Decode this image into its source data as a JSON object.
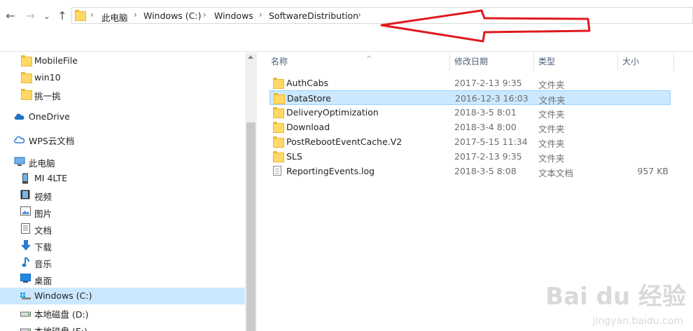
{
  "address": {
    "crumbs": [
      "此电脑",
      "Windows (C:)",
      "Windows",
      "SoftwareDistribution"
    ],
    "separator": "›"
  },
  "nav_glyphs": {
    "back": "←",
    "forward": "→",
    "recent": "⌄",
    "up": "↑"
  },
  "nav": {
    "items": [
      {
        "label": "MobileFile",
        "icon": "folder-icon"
      },
      {
        "label": "win10",
        "icon": "folder-icon"
      },
      {
        "label": "挑一挑",
        "icon": "folder-icon"
      },
      {
        "label": "OneDrive",
        "icon": "cloud-icon"
      },
      {
        "label": "WPS云文档",
        "icon": "wps-cloud-icon"
      },
      {
        "label": "此电脑",
        "icon": "computer-icon"
      },
      {
        "label": "MI 4LTE",
        "icon": "phone-icon"
      },
      {
        "label": "视频",
        "icon": "video-icon"
      },
      {
        "label": "图片",
        "icon": "picture-icon"
      },
      {
        "label": "文档",
        "icon": "document-icon"
      },
      {
        "label": "下载",
        "icon": "download-icon"
      },
      {
        "label": "音乐",
        "icon": "music-icon"
      },
      {
        "label": "桌面",
        "icon": "desktop-icon"
      },
      {
        "label": "Windows (C:)",
        "icon": "drive-icon"
      },
      {
        "label": "本地磁盘 (D:)",
        "icon": "drive-icon"
      },
      {
        "label": "本地磁盘 (E:)",
        "icon": "drive-icon"
      }
    ],
    "selected": "Windows (C:)"
  },
  "columns": {
    "name": "名称",
    "date": "修改日期",
    "type": "类型",
    "size": "大小"
  },
  "sort_caret": "^",
  "files": [
    {
      "name": "AuthCabs",
      "date": "2017-2-13 9:35",
      "type": "文件夹",
      "size": "",
      "icon": "folder-icon"
    },
    {
      "name": "DataStore",
      "date": "2016-12-3 16:03",
      "type": "文件夹",
      "size": "",
      "icon": "folder-icon"
    },
    {
      "name": "DeliveryOptimization",
      "date": "2018-3-5 8:01",
      "type": "文件夹",
      "size": "",
      "icon": "folder-icon"
    },
    {
      "name": "Download",
      "date": "2018-3-4 8:00",
      "type": "文件夹",
      "size": "",
      "icon": "folder-icon"
    },
    {
      "name": "PostRebootEventCache.V2",
      "date": "2017-5-15 11:34",
      "type": "文件夹",
      "size": "",
      "icon": "folder-icon"
    },
    {
      "name": "SLS",
      "date": "2017-2-13 9:35",
      "type": "文件夹",
      "size": "",
      "icon": "folder-icon"
    },
    {
      "name": "ReportingEvents.log",
      "date": "2018-3-5 8:08",
      "type": "文本文档",
      "size": "957 KB",
      "icon": "text-file-icon"
    }
  ],
  "selected_file": "DataStore",
  "watermark": {
    "main": "Bai du 经验",
    "sub": "jingyan.baidu.com"
  },
  "colors": {
    "selection": "#cce8ff",
    "annotation": "#e0191f"
  }
}
